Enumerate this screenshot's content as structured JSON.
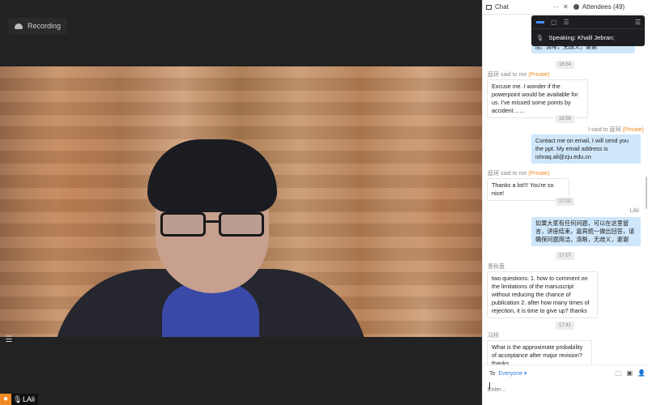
{
  "recording": {
    "label": "Recording"
  },
  "video": {
    "participant_name": "LAli"
  },
  "tabs": {
    "chat": "Chat",
    "attendees": "Attendees (49)",
    "more": "···",
    "close": "✕"
  },
  "speaking": {
    "text": "Speaking: Khalil Jebran;"
  },
  "messages": {
    "partial_top": "活。清晰，无歧义，谢谢",
    "t1": "16:54",
    "m1_sender": "庭珂 said to me",
    "m1_private": "(Private)",
    "m1_text": "Excuse me. I wonder if the powerpoint would be available for us. I've missed some points by accident……",
    "t2": "16:56",
    "m2_sender": "I said to 庭珂",
    "m2_private": "(Private)",
    "m2_text": "Contact me on email, I will send you the ppt. My email address is ishraq.ali@zju.edu.cn",
    "m3_sender": "庭珂 said to me",
    "m3_private": "(Private)",
    "m3_text": "Thanks a lot!!! You're so nice!",
    "t3": "17:02",
    "m4_sender": "LAli",
    "m4_text": "如果大家有任何问题，可以在这里留言，讲座结束，嘉宾统一做出回答，请确保问题简洁，清晰，无歧义，谢谢",
    "t4": "17:07",
    "m5_sender": "恩秋茵",
    "m5_text": "two questions: 1. how to comment on the limitations of the manuscript without reducing the chance of publication 2. after how many times of rejection, it is time to give up? thanks",
    "t5": "17:41",
    "m6_sender": "冯桢",
    "m6_text": "What is the approximate probability of acceptance after major revision? thanks"
  },
  "compose": {
    "to_label": "To",
    "to_value": "Everyone ▾",
    "placeholder": "Enter..."
  },
  "colors": {
    "accent": "#2f7de1",
    "private": "#f08a24",
    "bubble_out": "#cfe7fb"
  }
}
